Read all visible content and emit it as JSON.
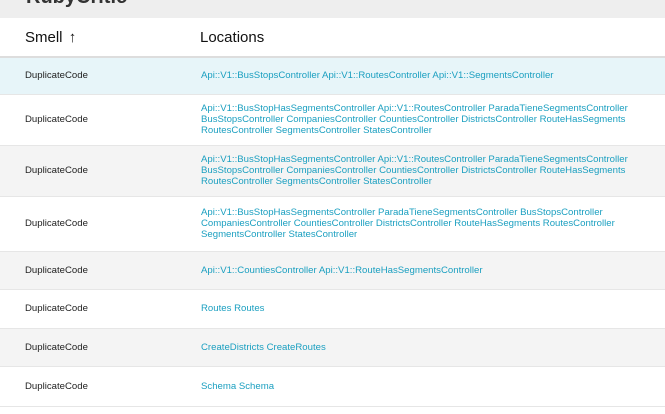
{
  "page": {
    "title": "RubyCritic"
  },
  "table": {
    "headers": {
      "smell": "Smell",
      "sort_indicator": "↑",
      "locations": "Locations"
    },
    "rows": [
      {
        "smell": "DuplicateCode",
        "locations": "Api::V1::BusStopsController Api::V1::RoutesController Api::V1::SegmentsController"
      },
      {
        "smell": "DuplicateCode",
        "locations": "Api::V1::BusStopHasSegmentsController Api::V1::RoutesController ParadaTieneSegmentsController BusStopsController CompaniesController CountiesController DistrictsController RouteHasSegments RoutesController SegmentsController StatesController"
      },
      {
        "smell": "DuplicateCode",
        "locations": "Api::V1::BusStopHasSegmentsController Api::V1::RoutesController ParadaTieneSegmentsController BusStopsController CompaniesController CountiesController DistrictsController RouteHasSegments RoutesController SegmentsController StatesController"
      },
      {
        "smell": "DuplicateCode",
        "locations": "Api::V1::BusStopHasSegmentsController ParadaTieneSegmentsController BusStopsController CompaniesController CountiesController DistrictsController RouteHasSegments RoutesController SegmentsController StatesController"
      },
      {
        "smell": "DuplicateCode",
        "locations": "Api::V1::CountiesController Api::V1::RouteHasSegmentsController"
      },
      {
        "smell": "DuplicateCode",
        "locations": "Routes Routes"
      },
      {
        "smell": "DuplicateCode",
        "locations": "CreateDistricts CreateRoutes"
      },
      {
        "smell": "DuplicateCode",
        "locations": "Schema Schema"
      }
    ]
  },
  "colors": {
    "link": "#1a9fc0",
    "row_highlight": "#e7f5f9",
    "row_stripe": "#f4f4f4",
    "header_bar": "#eeeeee"
  }
}
